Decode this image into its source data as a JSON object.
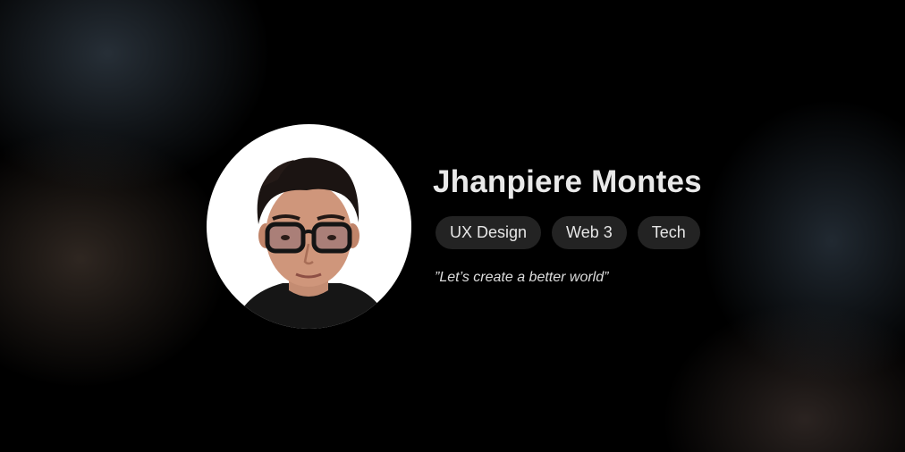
{
  "profile": {
    "name": "Jhanpiere Montes",
    "tags": [
      "UX Design",
      "Web 3",
      "Tech"
    ],
    "quote": "”Let’s create a better world”"
  },
  "colors": {
    "background": "#000000",
    "name_text": "#e9e9e9",
    "tag_background": "#232323",
    "tag_text": "#e6e6e6",
    "avatar_background": "#ffffff"
  }
}
